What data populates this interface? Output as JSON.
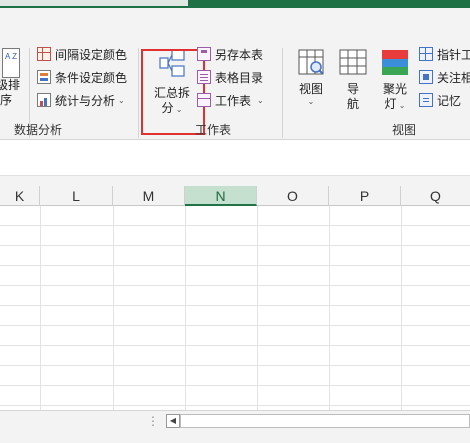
{
  "ribbon": {
    "groups": {
      "data_analysis": "数据分析",
      "worksheet": "工作表",
      "view": "视图"
    },
    "partial_left": {
      "icon_letters": "A Z",
      "label_line1": "级排",
      "label_line2": "序"
    },
    "data_analysis": {
      "interval_color": "间隔设定颜色",
      "cond_color": "条件设定颜色",
      "stats": "统计与分析"
    },
    "summary_split": {
      "line1": "汇总拆",
      "line2": "分"
    },
    "worksheet": {
      "save_as": "另存本表",
      "sheet_dir": "表格目录",
      "worksheet_menu": "工作表"
    },
    "view": {
      "view_btn": "视图",
      "nav_line1": "导",
      "nav_line2": "航",
      "spot_line1": "聚光",
      "spot_line2": "灯",
      "pointer": "指针工",
      "focus_rel": "关注相",
      "memo": "记忆"
    },
    "colors": {
      "spotlight_red": "#e83c3c",
      "spotlight_blue": "#3a8fd8",
      "spotlight_green": "#3aa655"
    }
  },
  "grid": {
    "columns": [
      "K",
      "L",
      "M",
      "N",
      "O",
      "P",
      "Q"
    ],
    "selected_column": "N"
  },
  "statusbar": {
    "scroll_dots": "⋮",
    "scroll_left_arrow": "◀"
  },
  "colors": {
    "accent": "#1e7145",
    "selected_header": "#c6e0cf",
    "highlight": "#e03030"
  }
}
